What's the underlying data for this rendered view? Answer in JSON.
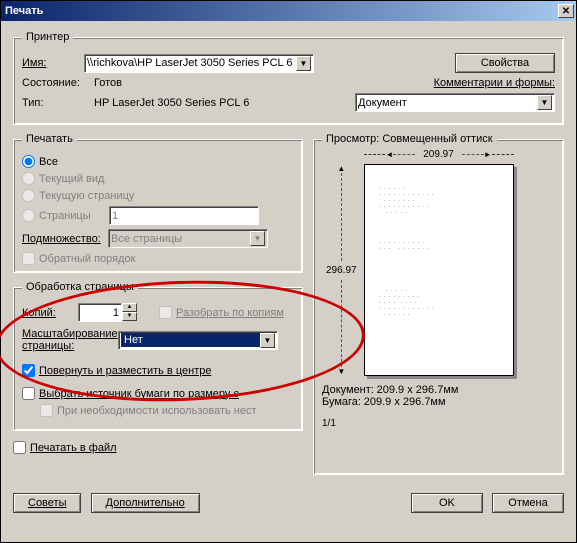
{
  "window": {
    "title": "Печать"
  },
  "printer": {
    "section_label": "Принтер",
    "name_label": "Имя:",
    "name_value": "\\\\richkova\\HP LaserJet 3050 Series PCL 6",
    "properties_btn": "Свойства",
    "state_label": "Состояние:",
    "state_value": "Готов",
    "type_label": "Тип:",
    "type_value": "HP LaserJet 3050 Series PCL 6",
    "comments_label": "Комментарии и формы:",
    "comments_value": "Документ"
  },
  "range": {
    "section_label": "Печатать",
    "all": "Все",
    "current_view": "Текущий вид",
    "current_page": "Текущую страницу",
    "pages": "Страницы",
    "pages_value": "1",
    "subset_label": "Подмножество:",
    "subset_value": "Все страницы",
    "reverse": "Обратный порядок"
  },
  "handling": {
    "section_label": "Обработка страницы",
    "copies_label": "Копий:",
    "copies_value": "1",
    "collate": "Разобрать по копиям",
    "scale_label": "Масштабирование страницы:",
    "scale_value": "Нет",
    "rotate": "Повернуть и разместить в центре",
    "source": "Выбрать источник бумаги по размеру с",
    "manual": "При необходимости использовать нест"
  },
  "print_to_file": "Печатать в файл",
  "preview": {
    "label": "Просмотр: Совмещенный оттиск",
    "width": "209.97",
    "height": "296.97",
    "doc_label": "Документ:",
    "doc_value": "209.9 x 296.7мм",
    "paper_label": "Бумага:",
    "paper_value": "209.9 x 296.7мм",
    "page": "1/1"
  },
  "buttons": {
    "tips": "Советы",
    "advanced": "Дополнительно",
    "ok": "OK",
    "cancel": "Отмена"
  }
}
